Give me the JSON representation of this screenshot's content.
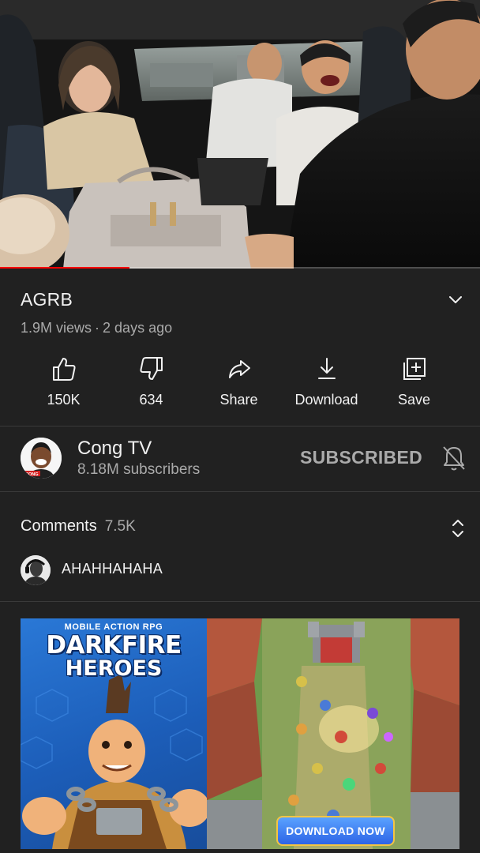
{
  "video": {
    "title": "AGRB",
    "views": "1.9M views",
    "separator": "·",
    "age": "2 days ago",
    "progress": 0.27
  },
  "actions": {
    "like": "150K",
    "dislike": "634",
    "share": "Share",
    "download": "Download",
    "save": "Save"
  },
  "channel": {
    "name": "Cong TV",
    "subscribers": "8.18M subscribers",
    "subscribe_state": "SUBSCRIBED",
    "avatar_badge": "CONG"
  },
  "comments": {
    "label": "Comments",
    "count": "7.5K",
    "top_comment": "AHAHHAHAHA"
  },
  "ad": {
    "tagline": "MOBILE ACTION RPG",
    "title_line1": "DARKFIRE",
    "title_line2": "HEROES",
    "cta": "DOWNLOAD NOW"
  },
  "colors": {
    "background": "#212121",
    "progress": "#ff0000",
    "text_primary": "#f1f1f1",
    "text_secondary": "#aaaaaa"
  },
  "icons": {
    "like": "thumbs-up-icon",
    "dislike": "thumbs-down-icon",
    "share": "share-arrow-icon",
    "download": "download-icon",
    "save": "add-to-playlist-icon",
    "notifications": "bell-off-icon",
    "expand": "chevron-down-icon",
    "sort": "unfold-icon"
  }
}
